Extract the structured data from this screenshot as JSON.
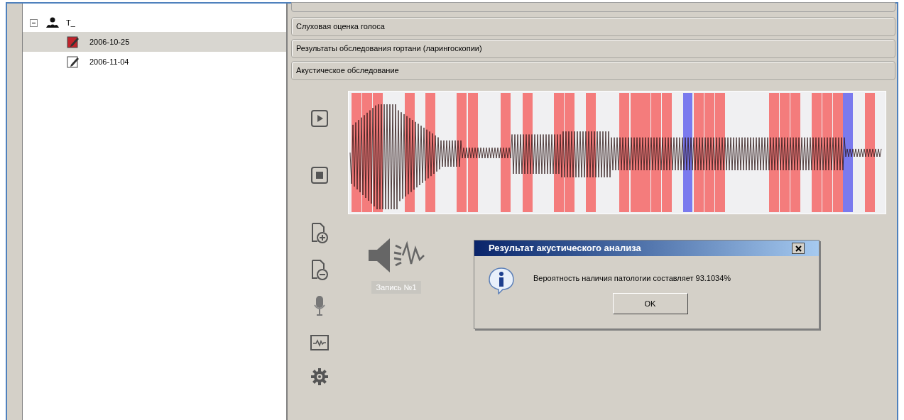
{
  "tree": {
    "root": {
      "label": "T_",
      "expanded": true,
      "children": [
        {
          "label": "2006-10-25",
          "selected": true
        },
        {
          "label": "2006-11-04",
          "selected": false
        }
      ]
    }
  },
  "sections": [
    "Слуховая оценка голоса",
    "Результаты обследования гортани (ларингоскопии)",
    "Акустическое обследование"
  ],
  "recording": {
    "label": "Запись №1"
  },
  "dialog": {
    "title": "Результат акустического анализа",
    "message": "Вероятность наличия патологии составляет 93.1034%",
    "ok": "OK"
  }
}
